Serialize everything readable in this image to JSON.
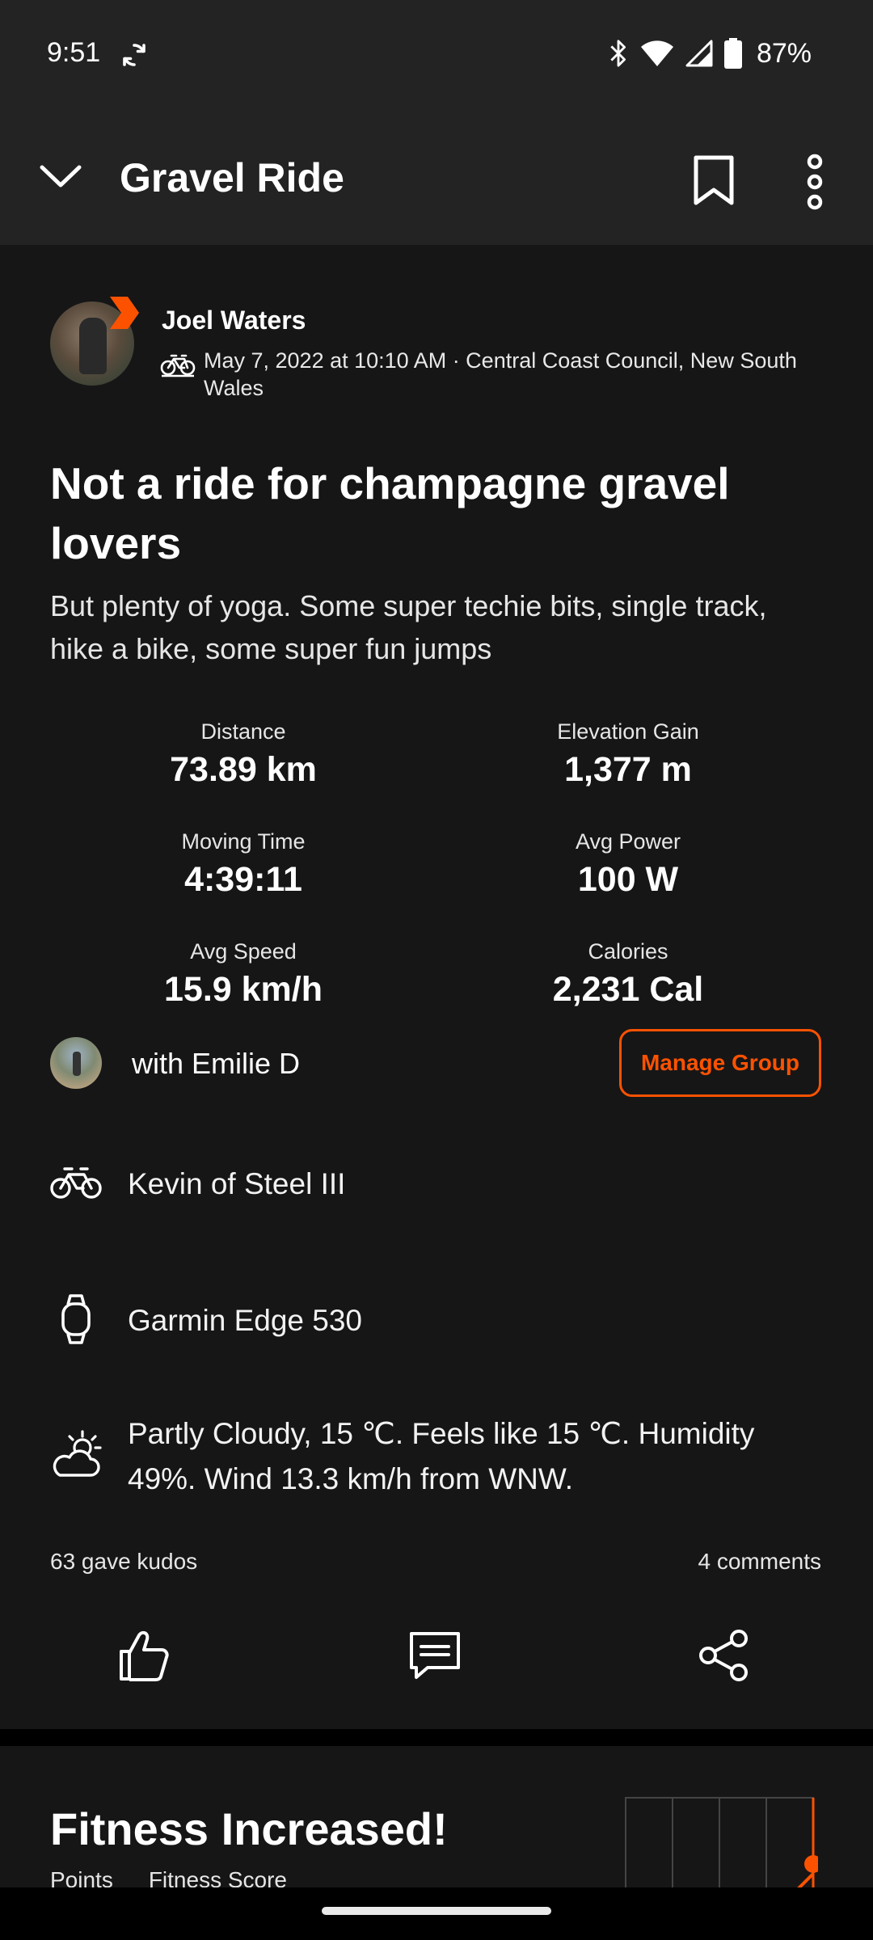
{
  "status_bar": {
    "time": "9:51",
    "battery_percent": "87%",
    "icons": [
      "sync-icon",
      "bluetooth-icon",
      "wifi-icon",
      "cell-signal-icon",
      "battery-icon"
    ]
  },
  "app_bar": {
    "title": "Gravel Ride",
    "icons": [
      "chevron-down-icon",
      "bookmark-icon",
      "more-vert-icon"
    ]
  },
  "activity": {
    "athlete_name": "Joel Waters",
    "meta": "May 7, 2022 at 10:10 AM · Central Coast Council, New South Wales",
    "title": "Not a ride for champagne gravel lovers",
    "description": "But plenty of yoga. Some super techie bits, single track, hike a bike, some super fun jumps"
  },
  "stats": [
    {
      "label": "Distance",
      "value": "73.89 km"
    },
    {
      "label": "Elevation Gain",
      "value": "1,377 m"
    },
    {
      "label": "Moving Time",
      "value": "4:39:11"
    },
    {
      "label": "Avg Power",
      "value": "100 W"
    },
    {
      "label": "Avg Speed",
      "value": "15.9 km/h"
    },
    {
      "label": "Calories",
      "value": "2,231 Cal"
    }
  ],
  "group": {
    "text": "with Emilie D",
    "manage_label": "Manage Group"
  },
  "details": {
    "bike": "Kevin of Steel III",
    "device": "Garmin Edge 530",
    "weather": "Partly Cloudy, 15 ℃. Feels like 15 ℃. Humidity 49%. Wind 13.3 km/h from WNW."
  },
  "social": {
    "kudos": "63 gave kudos",
    "comments": "4 comments"
  },
  "fitness": {
    "title": "Fitness Increased!",
    "sub_labels": [
      "Points",
      "Fitness Score"
    ]
  },
  "colors": {
    "accent": "#fc5200",
    "card_bg": "#161617",
    "bar_bg": "#232323"
  }
}
